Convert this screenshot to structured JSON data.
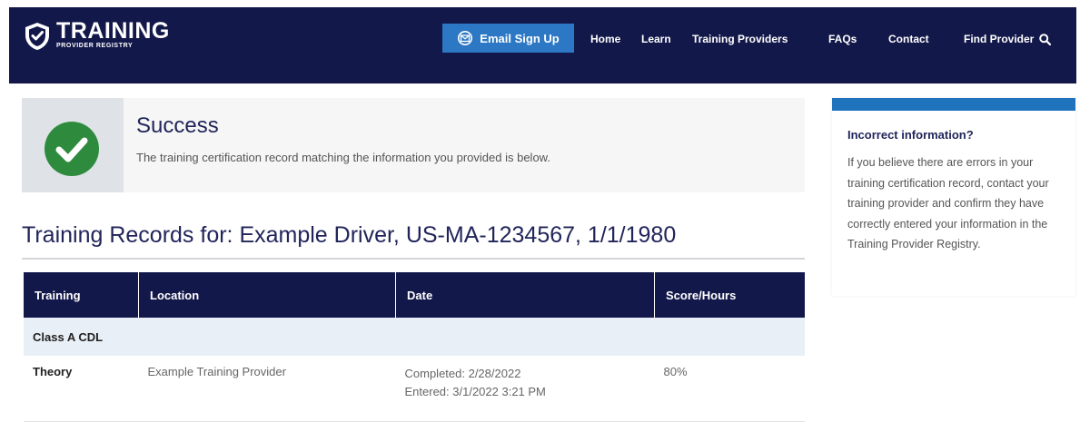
{
  "header": {
    "logo": {
      "title": "TRAINING",
      "subtitle": "PROVIDER REGISTRY"
    },
    "email_button": "Email Sign Up",
    "nav": {
      "home": "Home",
      "learn": "Learn",
      "training_providers": "Training Providers",
      "faqs": "FAQs",
      "contact": "Contact",
      "find_provider": "Find Provider"
    },
    "icons": {
      "email": "email-envelope-icon",
      "search": "search-icon",
      "logo": "shield-check-icon"
    }
  },
  "success": {
    "title": "Success",
    "message": "The training certification record matching the information you provided is below.",
    "icon": "check-circle-icon"
  },
  "records": {
    "title": "Training Records for: Example Driver, US-MA-1234567, 1/1/1980",
    "columns": [
      "Training",
      "Location",
      "Date",
      "Score/Hours"
    ],
    "group_label": "Class A CDL",
    "rows": [
      {
        "training": "Theory",
        "location": "Example Training Provider",
        "completed": "Completed: 2/28/2022",
        "entered": "Entered: 3/1/2022 3:21 PM",
        "score": "80%"
      }
    ]
  },
  "sidebar": {
    "title": "Incorrect information?",
    "body": "If you believe there are errors in your training certification record, contact your training provider and confirm they have correctly entered your information in the Training Provider Registry."
  },
  "colors": {
    "header_bg": "#13184a",
    "accent_blue": "#2d78c4",
    "success_green": "#2e8b3d",
    "sidebar_bar": "#1f73bd",
    "group_row_bg": "#e9eff6"
  }
}
